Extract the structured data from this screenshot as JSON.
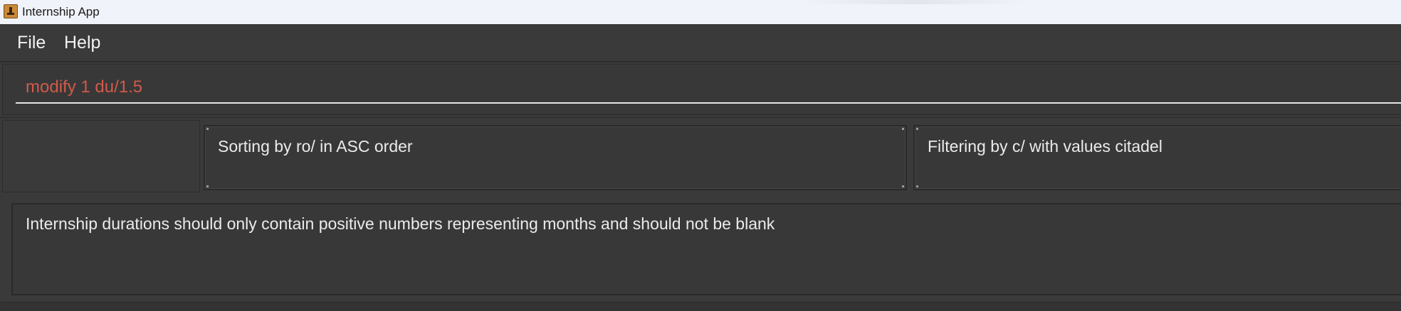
{
  "window": {
    "title": "Internship App",
    "icon": "app-icon"
  },
  "menubar": {
    "items": [
      {
        "label": "File"
      },
      {
        "label": "Help"
      }
    ]
  },
  "command_box": {
    "value": "modify 1 du/1.5",
    "text_color": "#d25a4a"
  },
  "status": {
    "sort": "Sorting by ro/ in ASC order",
    "filter": "Filtering by c/ with values citadel"
  },
  "result": {
    "message": "Internship durations should only contain positive numbers representing months and should not be blank"
  },
  "colors": {
    "background": "#3a3a3a",
    "panel": "#383838",
    "titlebar": "#f0f3f9",
    "text": "#ebebeb",
    "error_text": "#d25a4a"
  }
}
